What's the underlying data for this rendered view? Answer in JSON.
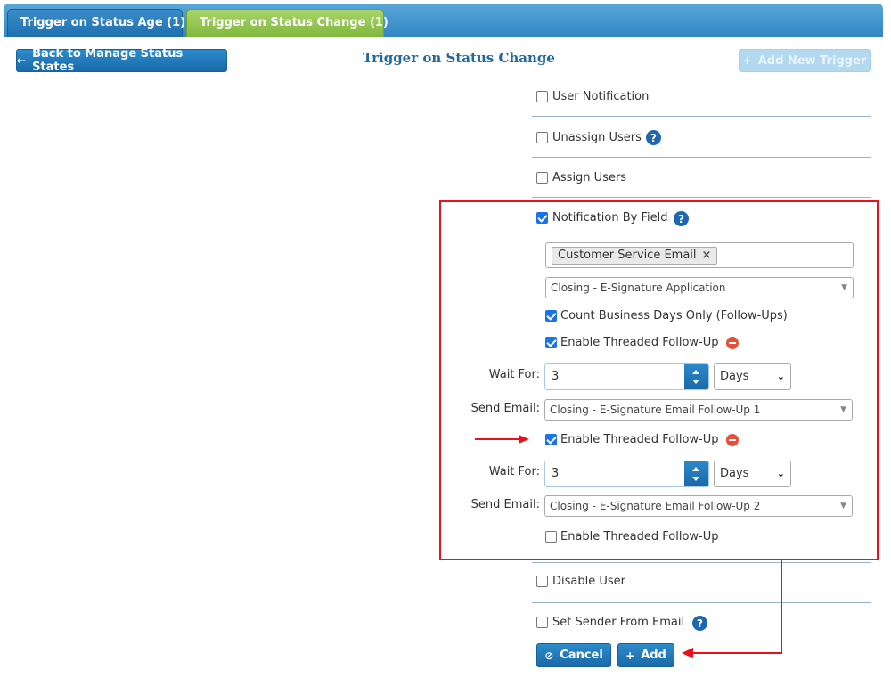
{
  "tabs": [
    {
      "label": "Trigger on Status Age (1)"
    },
    {
      "label": "Trigger on Status Change (1)"
    }
  ],
  "toolbar": {
    "back_label": "Back to Manage Status States",
    "title": "Trigger on Status Change",
    "add_new_label": "Add New Trigger"
  },
  "options": {
    "user_notification": "User Notification",
    "unassign_users": "Unassign Users",
    "assign_users": "Assign Users",
    "notification_by_field": "Notification By Field",
    "disable_user": "Disable User",
    "set_sender_from_email": "Set Sender From Email"
  },
  "notification": {
    "field_tag": "Customer Service Email",
    "template_select": "Closing - E-Signature Application",
    "count_business_days": "Count Business Days Only (Follow-Ups)",
    "followups": [
      {
        "enable_label": "Enable Threaded Follow-Up",
        "wait_label": "Wait For:",
        "wait_value": "3",
        "unit": "Days",
        "send_label": "Send Email:",
        "email": "Closing - E-Signature Email Follow-Up 1"
      },
      {
        "enable_label": "Enable Threaded Follow-Up",
        "wait_label": "Wait For:",
        "wait_value": "3",
        "unit": "Days",
        "send_label": "Send Email:",
        "email": "Closing - E-Signature Email Follow-Up 2"
      }
    ],
    "next_followup_label": "Enable Threaded Follow-Up"
  },
  "actions": {
    "cancel_label": "Cancel",
    "add_label": "Add"
  },
  "colors": {
    "accent_blue": "#1f6aa0",
    "tab_active_green": "#7fb83b",
    "highlight_red": "#e8121b"
  }
}
